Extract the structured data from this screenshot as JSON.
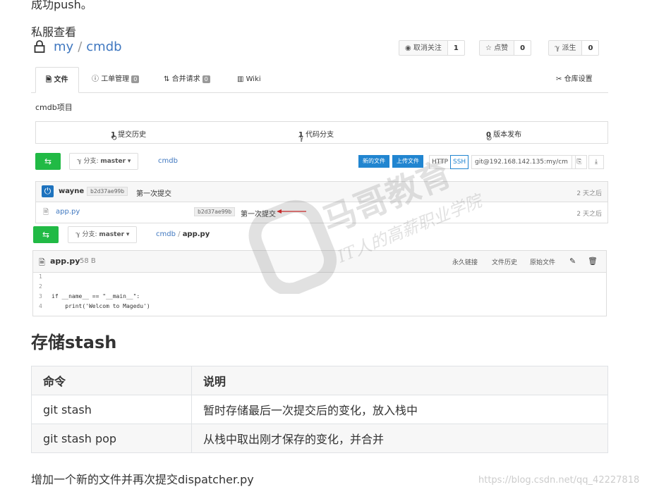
{
  "top_line": "成功push。",
  "section_label": "私服查看",
  "repo": {
    "owner": "my",
    "name": "cmdb",
    "unwatch_label": "◉ 取消关注",
    "unwatch_count": "1",
    "star_label": "☆ 点赞",
    "star_count": "0",
    "fork_label": "ℽ 派生",
    "fork_count": "0"
  },
  "tabs": {
    "files": "文件",
    "issues": "工单管理",
    "issues_count": "0",
    "pulls": "合并请求",
    "pulls_count": "0",
    "wiki": "Wiki",
    "settings": "仓库设置"
  },
  "description": "cmdb项目",
  "stats": {
    "commits_num": "1",
    "commits_label": "提交历史",
    "branches_num": "1",
    "branches_label": "代码分支",
    "releases_num": "0",
    "releases_label": "版本发布"
  },
  "branch_bar": {
    "branch_prefix": "分支:",
    "branch_name": "master",
    "crumb": "cmdb",
    "new_file": "新的文件",
    "upload_file": "上传文件",
    "http": "HTTP",
    "ssh": "SSH",
    "clone_url": "git@192.168.142.135:my/cm"
  },
  "latest_commit": {
    "author": "wayne",
    "sha": "b2d37ae99b",
    "message": "第一次提交",
    "time": "2 天之后"
  },
  "file_row": {
    "name": "app.py",
    "sha": "b2d37ae99b",
    "message": "第一次提交",
    "time": "2 天之后"
  },
  "branch_bar2": {
    "branch_prefix": "分支:",
    "branch_name": "master",
    "crumb_repo": "cmdb",
    "crumb_sep": "/",
    "crumb_file": "app.py"
  },
  "file_view": {
    "name": "app.py",
    "size": "58 B",
    "permalink": "永久链接",
    "history": "文件历史",
    "raw": "原始文件",
    "lines": [
      {
        "n": "1",
        "t": ""
      },
      {
        "n": "2",
        "t": ""
      },
      {
        "n": "3",
        "t": "if __name__ == \"__main__\":"
      },
      {
        "n": "4",
        "t": "    print('Welcom to Magedu')"
      }
    ]
  },
  "watermark": {
    "brand": "马哥教育",
    "slogan": "IT人的高薪职业学院"
  },
  "heading": "存储stash",
  "table": {
    "headers": [
      "命令",
      "说明"
    ],
    "rows": [
      [
        "git stash",
        "暂时存储最后一次提交后的变化，放入栈中"
      ],
      [
        "git stash pop",
        "从栈中取出刚才保存的变化，并合并"
      ]
    ]
  },
  "bottom_line": "增加一个新的文件并再次提交dispatcher.py",
  "footnote": "https://blog.csdn.net/qq_42227818"
}
